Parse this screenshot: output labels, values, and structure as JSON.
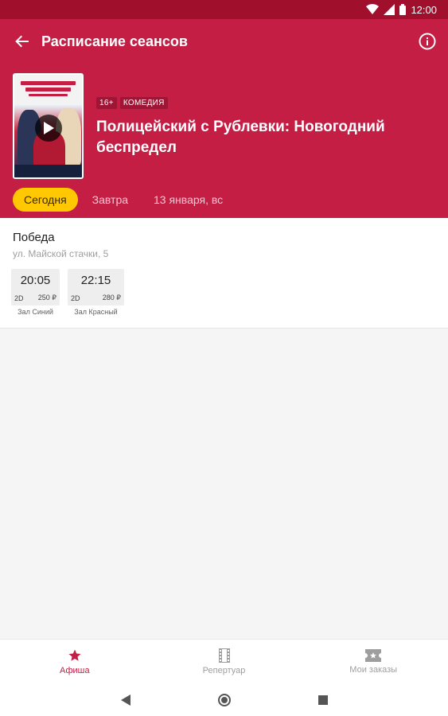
{
  "status_bar": {
    "time": "12:00"
  },
  "toolbar": {
    "title": "Расписание сеансов"
  },
  "movie": {
    "age_rating": "16+",
    "genre": "КОМЕДИЯ",
    "title": "Полицейский с Рублевки: Новогодний беспредел"
  },
  "date_tabs": [
    {
      "label": "Сегодня",
      "active": true
    },
    {
      "label": "Завтра",
      "active": false
    },
    {
      "label": "13 января, вс",
      "active": false
    }
  ],
  "cinema": {
    "name": "Победа",
    "address": "ул. Майской стачки, 5",
    "sessions": [
      {
        "time": "20:05",
        "format": "2D",
        "price": "250 ₽",
        "hall": "Зал Синий"
      },
      {
        "time": "22:15",
        "format": "2D",
        "price": "280 ₽",
        "hall": "Зал Красный"
      }
    ]
  },
  "bottom_nav": [
    {
      "label": "Афиша",
      "icon": "star-icon",
      "active": true
    },
    {
      "label": "Репертуар",
      "icon": "film-strip-icon",
      "active": false
    },
    {
      "label": "Мои заказы",
      "icon": "ticket-icon",
      "active": false
    }
  ],
  "colors": {
    "primary": "#c41e45",
    "status_bar": "#a0102d",
    "accent": "#ffc800"
  }
}
